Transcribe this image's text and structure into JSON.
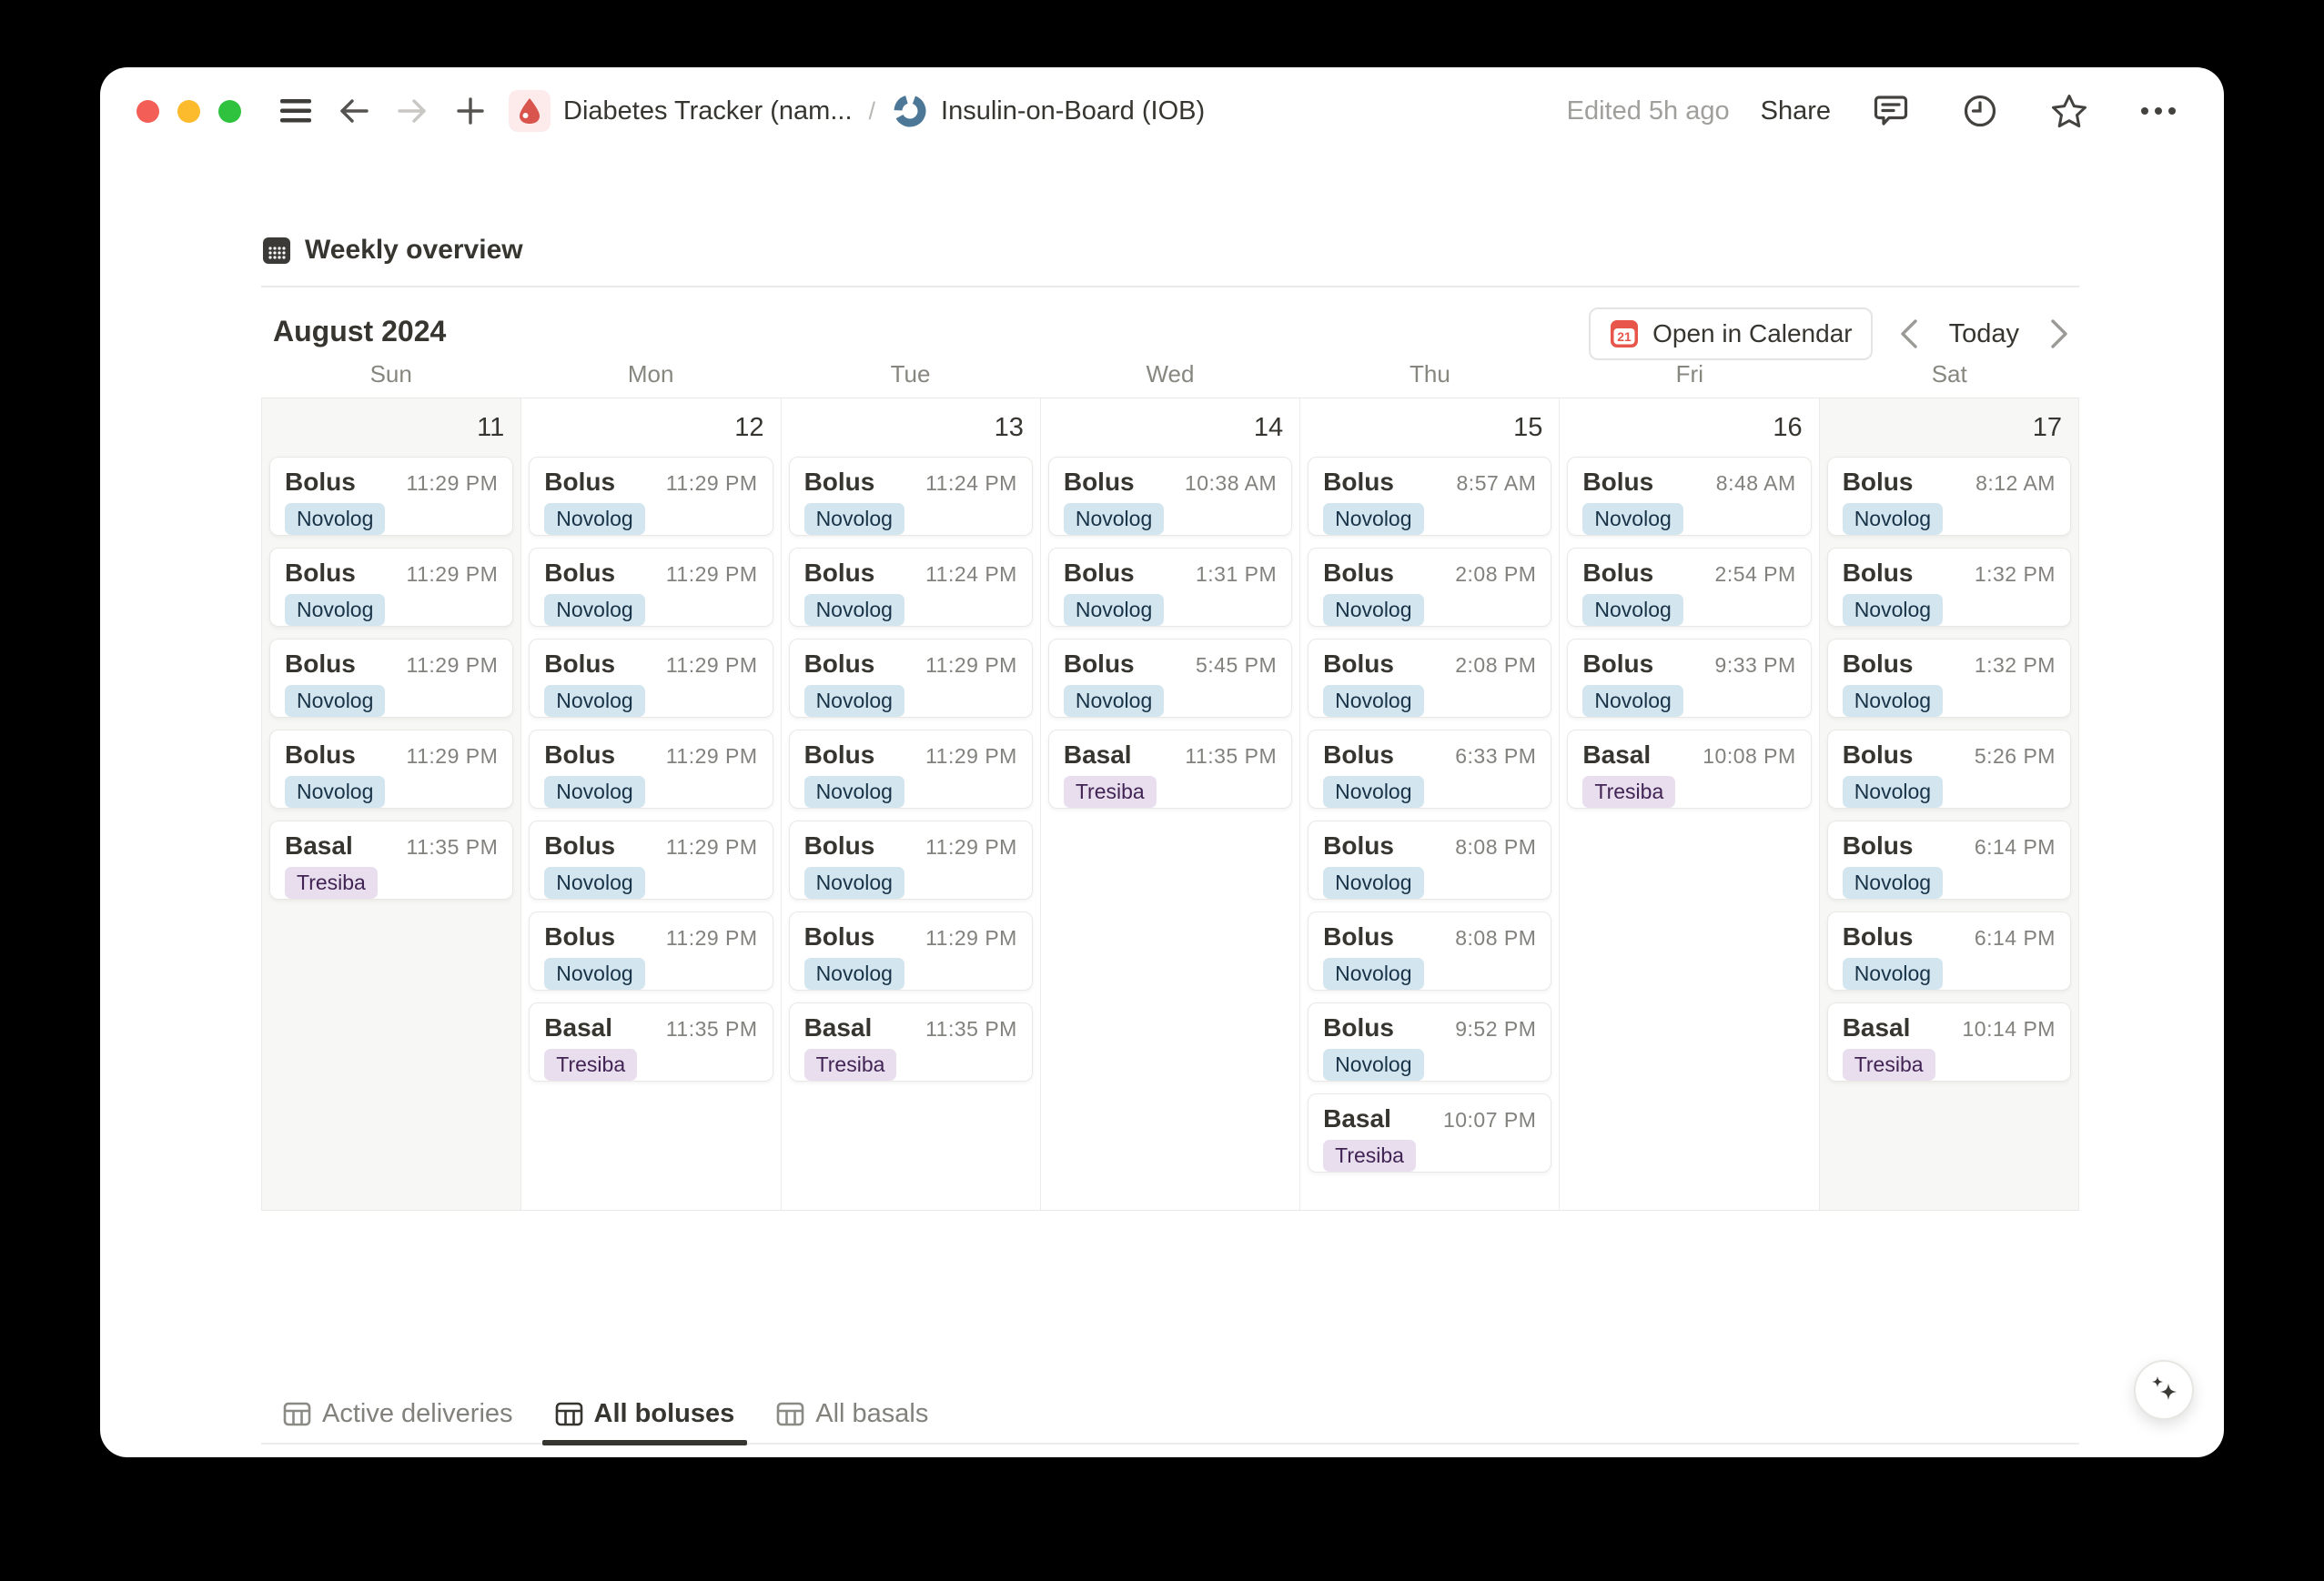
{
  "window": {
    "breadcrumb": {
      "root": "Diabetes Tracker (nam...",
      "separator": "/",
      "page": "Insulin-on-Board (IOB)"
    },
    "edited": "Edited 5h ago",
    "share_label": "Share"
  },
  "page": {
    "view_title": "Weekly overview",
    "month_title": "August 2024",
    "open_in_calendar": {
      "label": "Open in Calendar",
      "icon_day": "21"
    },
    "today_label": "Today"
  },
  "calendar": {
    "day_names": [
      "Sun",
      "Mon",
      "Tue",
      "Wed",
      "Thu",
      "Fri",
      "Sat"
    ],
    "tag_styles": {
      "Novolog": {
        "bg": "#d3e5ef",
        "fg": "#183347"
      },
      "Tresiba": {
        "bg": "#e8deee",
        "fg": "#412454"
      }
    },
    "days": [
      {
        "date": "11",
        "weekend": true,
        "events": [
          {
            "title": "Bolus",
            "time": "11:29 PM",
            "tag": "Novolog"
          },
          {
            "title": "Bolus",
            "time": "11:29 PM",
            "tag": "Novolog"
          },
          {
            "title": "Bolus",
            "time": "11:29 PM",
            "tag": "Novolog"
          },
          {
            "title": "Bolus",
            "time": "11:29 PM",
            "tag": "Novolog"
          },
          {
            "title": "Basal",
            "time": "11:35 PM",
            "tag": "Tresiba"
          }
        ]
      },
      {
        "date": "12",
        "weekend": false,
        "events": [
          {
            "title": "Bolus",
            "time": "11:29 PM",
            "tag": "Novolog"
          },
          {
            "title": "Bolus",
            "time": "11:29 PM",
            "tag": "Novolog"
          },
          {
            "title": "Bolus",
            "time": "11:29 PM",
            "tag": "Novolog"
          },
          {
            "title": "Bolus",
            "time": "11:29 PM",
            "tag": "Novolog"
          },
          {
            "title": "Bolus",
            "time": "11:29 PM",
            "tag": "Novolog"
          },
          {
            "title": "Bolus",
            "time": "11:29 PM",
            "tag": "Novolog"
          },
          {
            "title": "Basal",
            "time": "11:35 PM",
            "tag": "Tresiba"
          }
        ]
      },
      {
        "date": "13",
        "weekend": false,
        "events": [
          {
            "title": "Bolus",
            "time": "11:24 PM",
            "tag": "Novolog"
          },
          {
            "title": "Bolus",
            "time": "11:24 PM",
            "tag": "Novolog"
          },
          {
            "title": "Bolus",
            "time": "11:29 PM",
            "tag": "Novolog"
          },
          {
            "title": "Bolus",
            "time": "11:29 PM",
            "tag": "Novolog"
          },
          {
            "title": "Bolus",
            "time": "11:29 PM",
            "tag": "Novolog"
          },
          {
            "title": "Bolus",
            "time": "11:29 PM",
            "tag": "Novolog"
          },
          {
            "title": "Basal",
            "time": "11:35 PM",
            "tag": "Tresiba"
          }
        ]
      },
      {
        "date": "14",
        "weekend": false,
        "events": [
          {
            "title": "Bolus",
            "time": "10:38 AM",
            "tag": "Novolog"
          },
          {
            "title": "Bolus",
            "time": "1:31 PM",
            "tag": "Novolog"
          },
          {
            "title": "Bolus",
            "time": "5:45 PM",
            "tag": "Novolog"
          },
          {
            "title": "Basal",
            "time": "11:35 PM",
            "tag": "Tresiba"
          }
        ]
      },
      {
        "date": "15",
        "weekend": false,
        "events": [
          {
            "title": "Bolus",
            "time": "8:57 AM",
            "tag": "Novolog"
          },
          {
            "title": "Bolus",
            "time": "2:08 PM",
            "tag": "Novolog"
          },
          {
            "title": "Bolus",
            "time": "2:08 PM",
            "tag": "Novolog"
          },
          {
            "title": "Bolus",
            "time": "6:33 PM",
            "tag": "Novolog"
          },
          {
            "title": "Bolus",
            "time": "8:08 PM",
            "tag": "Novolog"
          },
          {
            "title": "Bolus",
            "time": "8:08 PM",
            "tag": "Novolog"
          },
          {
            "title": "Bolus",
            "time": "9:52 PM",
            "tag": "Novolog"
          },
          {
            "title": "Basal",
            "time": "10:07 PM",
            "tag": "Tresiba"
          }
        ]
      },
      {
        "date": "16",
        "weekend": false,
        "events": [
          {
            "title": "Bolus",
            "time": "8:48 AM",
            "tag": "Novolog"
          },
          {
            "title": "Bolus",
            "time": "2:54 PM",
            "tag": "Novolog"
          },
          {
            "title": "Bolus",
            "time": "9:33 PM",
            "tag": "Novolog"
          },
          {
            "title": "Basal",
            "time": "10:08 PM",
            "tag": "Tresiba"
          }
        ]
      },
      {
        "date": "17",
        "weekend": true,
        "events": [
          {
            "title": "Bolus",
            "time": "8:12 AM",
            "tag": "Novolog"
          },
          {
            "title": "Bolus",
            "time": "1:32 PM",
            "tag": "Novolog"
          },
          {
            "title": "Bolus",
            "time": "1:32 PM",
            "tag": "Novolog"
          },
          {
            "title": "Bolus",
            "time": "5:26 PM",
            "tag": "Novolog"
          },
          {
            "title": "Bolus",
            "time": "6:14 PM",
            "tag": "Novolog"
          },
          {
            "title": "Bolus",
            "time": "6:14 PM",
            "tag": "Novolog"
          },
          {
            "title": "Basal",
            "time": "10:14 PM",
            "tag": "Tresiba"
          }
        ]
      }
    ]
  },
  "tabs": [
    {
      "label": "Active deliveries",
      "active": false
    },
    {
      "label": "All boluses",
      "active": true
    },
    {
      "label": "All basals",
      "active": false
    }
  ],
  "colors": {
    "text": "#37352f",
    "muted_text": "#82817d",
    "weekend_bg": "#f7f7f5",
    "novolog_tag_bg": "#d3e5ef",
    "tresiba_tag_bg": "#e8deee",
    "accent_red": "#d9544d",
    "iob_icon_blue": "#4d7796",
    "traffic_red": "#f35e56",
    "traffic_yellow": "#fcbb2d",
    "traffic_green": "#2fc23e"
  }
}
